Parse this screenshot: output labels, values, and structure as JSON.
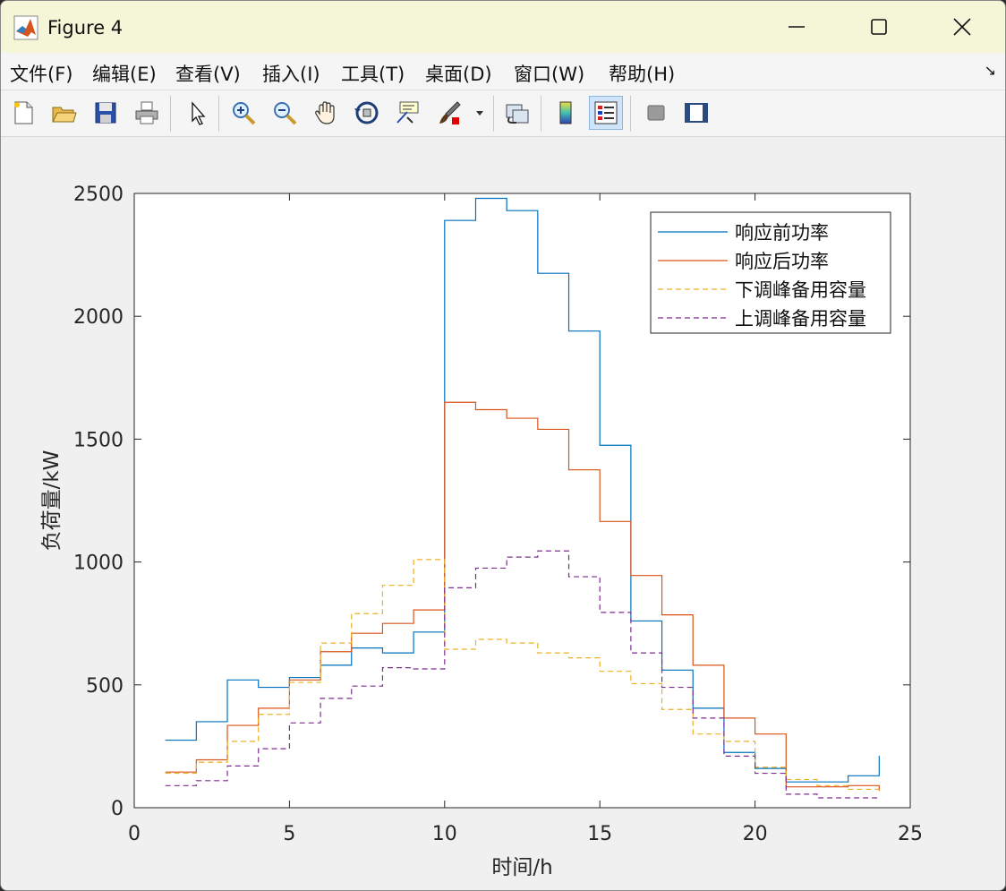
{
  "window": {
    "title": "Figure 4",
    "icon": "matlab-logo-icon"
  },
  "menu": [
    "文件(F)",
    "编辑(E)",
    "查看(V)",
    "插入(I)",
    "工具(T)",
    "桌面(D)",
    "窗口(W)",
    "帮助(H)"
  ],
  "menu_corner_icon": "dock-arrow-icon",
  "toolbar": [
    "new-figure-icon",
    "open-file-icon",
    "save-icon",
    "print-icon",
    "select-arrow-icon",
    "zoom-in-icon",
    "zoom-out-icon",
    "pan-hand-icon",
    "rotate-3d-icon",
    "data-cursor-icon",
    "brush-icon",
    "link-plot-icon",
    "colorbar-icon",
    "legend-icon",
    "hide-plot-tools-icon",
    "show-plot-tools-icon"
  ],
  "chart_data": {
    "type": "line",
    "style": "stairs",
    "xlabel": "时间/h",
    "ylabel": "负荷量/kW",
    "xlim": [
      0,
      25
    ],
    "ylim": [
      0,
      2500
    ],
    "xticks": [
      0,
      5,
      10,
      15,
      20,
      25
    ],
    "yticks": [
      0,
      500,
      1000,
      1500,
      2000,
      2500
    ],
    "grid": false,
    "legend_position": "top-right",
    "x": [
      1,
      2,
      3,
      4,
      5,
      6,
      7,
      8,
      9,
      10,
      11,
      12,
      13,
      14,
      15,
      16,
      17,
      18,
      19,
      20,
      21,
      22,
      23,
      24
    ],
    "series": [
      {
        "name": "响应前功率",
        "color": "#0072BD",
        "dash": "solid",
        "values": [
          275,
          350,
          520,
          490,
          530,
          580,
          650,
          630,
          715,
          2390,
          2480,
          2430,
          2175,
          1940,
          1475,
          760,
          560,
          405,
          225,
          160,
          105,
          105,
          130,
          210
        ]
      },
      {
        "name": "响应后功率",
        "color": "#D95319",
        "dash": "solid",
        "values": [
          145,
          195,
          335,
          405,
          520,
          635,
          710,
          750,
          805,
          1650,
          1620,
          1585,
          1540,
          1375,
          1165,
          945,
          785,
          580,
          365,
          300,
          85,
          85,
          90,
          70
        ]
      },
      {
        "name": "下调峰备用容量",
        "color": "#EDB120",
        "dash": "dashed",
        "values": [
          140,
          185,
          270,
          380,
          510,
          670,
          790,
          905,
          1010,
          645,
          685,
          670,
          630,
          610,
          555,
          505,
          400,
          300,
          270,
          165,
          115,
          90,
          75,
          75
        ]
      },
      {
        "name": "上调峰备用容量",
        "color": "#7E2F8E",
        "dash": "dashed",
        "values": [
          90,
          110,
          170,
          240,
          345,
          445,
          495,
          570,
          565,
          895,
          975,
          1020,
          1045,
          940,
          795,
          630,
          490,
          365,
          210,
          140,
          55,
          40,
          40,
          40
        ]
      }
    ]
  }
}
